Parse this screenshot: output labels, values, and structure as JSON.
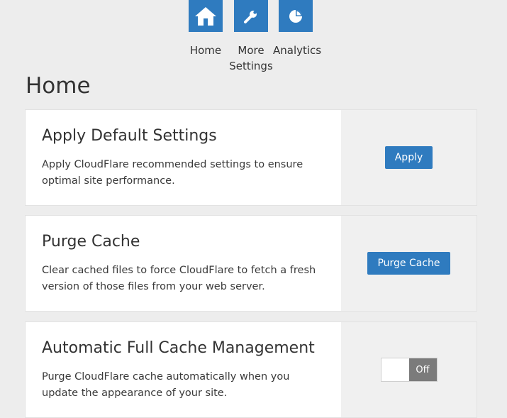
{
  "nav": {
    "items": [
      {
        "label": "Home",
        "icon": "home-icon"
      },
      {
        "label": "More Settings",
        "icon": "wrench-icon"
      },
      {
        "label": "Analytics",
        "icon": "pie-chart-icon"
      }
    ],
    "tile_color": "#2f7bbf"
  },
  "page": {
    "title": "Home"
  },
  "cards": [
    {
      "title": "Apply Default Settings",
      "description": "Apply CloudFlare recommended settings to ensure optimal site performance.",
      "action_label": "Apply"
    },
    {
      "title": "Purge Cache",
      "description": "Clear cached files to force CloudFlare to fetch a fresh version of those files from your web server.",
      "action_label": "Purge Cache"
    },
    {
      "title": "Automatic Full Cache Management",
      "description": "Purge CloudFlare cache automatically when you update the appearance of your site.",
      "toggle_label": "Off"
    }
  ],
  "colors": {
    "accent": "#2f7bbf",
    "toggle_off": "#7b7b7b",
    "background": "#ededed"
  }
}
